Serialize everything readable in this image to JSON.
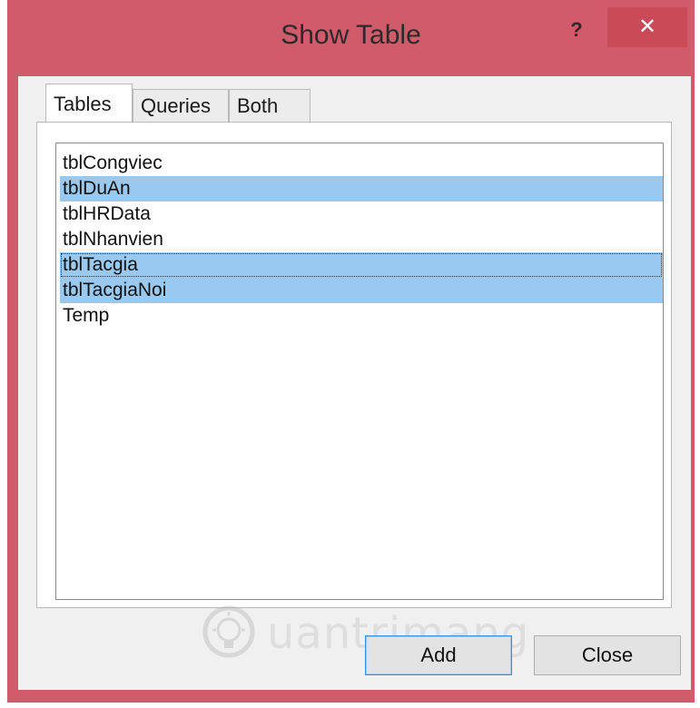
{
  "window": {
    "title": "Show Table",
    "help_label": "?",
    "close_label": "✕"
  },
  "tabs": [
    {
      "label": "Tables",
      "active": true
    },
    {
      "label": "Queries",
      "active": false
    },
    {
      "label": "Both",
      "active": false
    }
  ],
  "list": {
    "items": [
      {
        "label": "tblCongviec",
        "selected": false
      },
      {
        "label": "tblDuAn",
        "selected": true
      },
      {
        "label": "tblHRData",
        "selected": false
      },
      {
        "label": "tblNhanvien",
        "selected": false
      },
      {
        "label": "tblTacgia",
        "selected": true,
        "focused": true
      },
      {
        "label": "tblTacgiaNoi",
        "selected": true
      },
      {
        "label": "Temp",
        "selected": false
      }
    ]
  },
  "buttons": {
    "add_label": "Add",
    "close_label": "Close"
  },
  "watermark": {
    "text": "uantrimang"
  },
  "colors": {
    "title_bar": "#cf5b6b",
    "close_button": "#c84b57",
    "selection": "#99c9ef"
  }
}
